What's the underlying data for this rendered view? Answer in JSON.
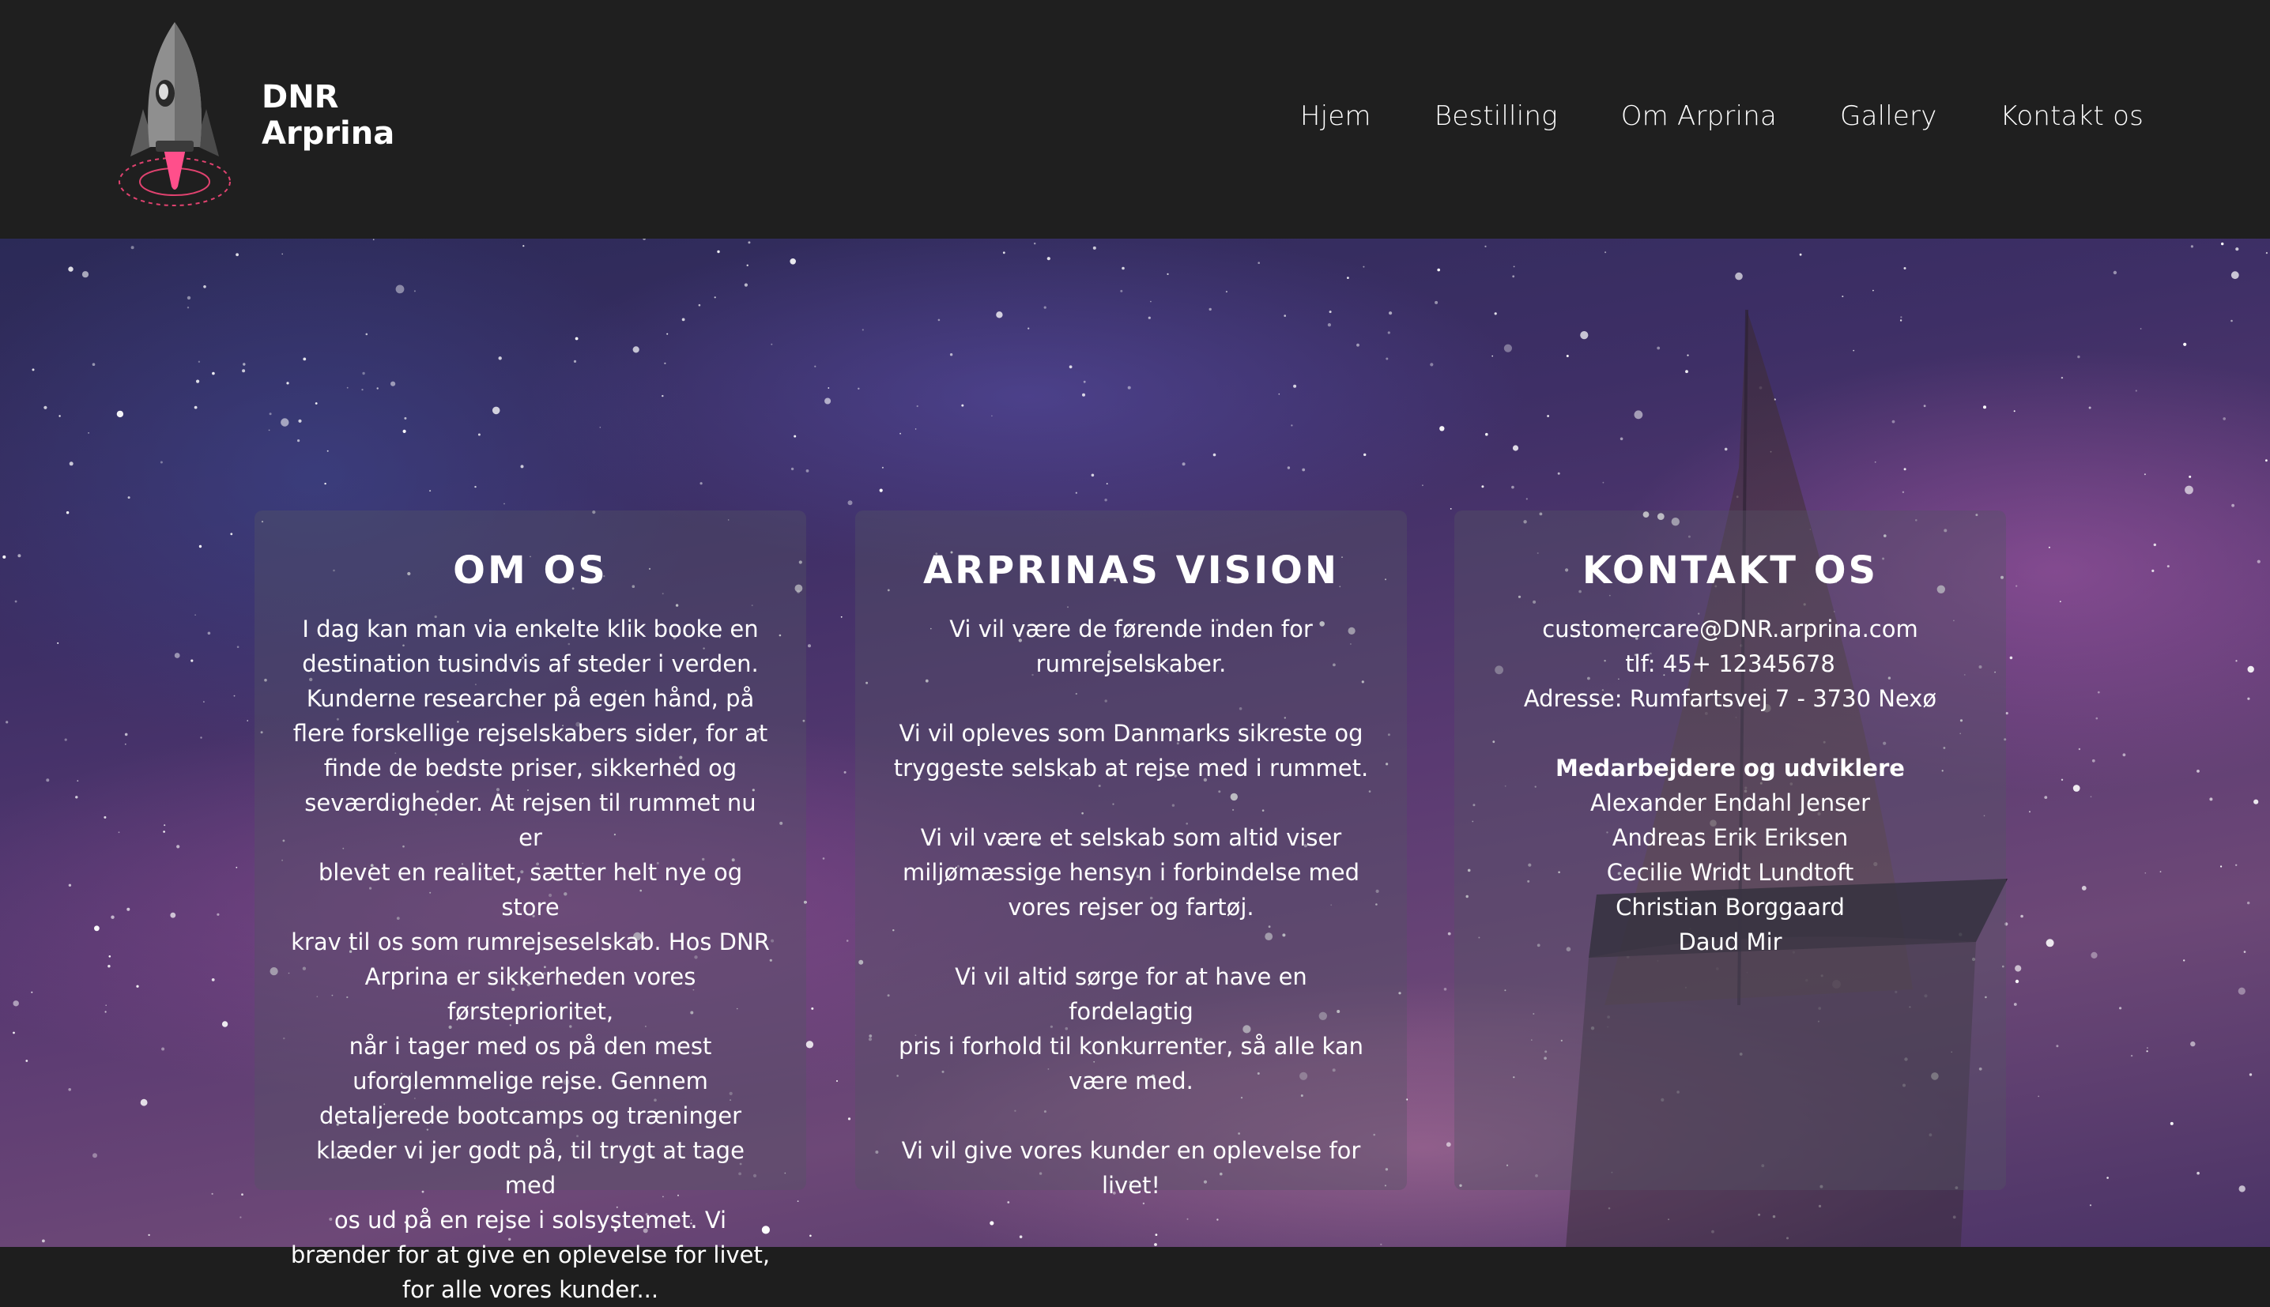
{
  "header": {
    "brand_line1": "DNR",
    "brand_line2": "Arprina",
    "nav": [
      {
        "label": "Hjem"
      },
      {
        "label": "Bestilling"
      },
      {
        "label": "Om Arprina"
      },
      {
        "label": "Gallery"
      },
      {
        "label": "Kontakt os"
      }
    ]
  },
  "about": {
    "title": "OM OS",
    "text": [
      "I dag kan man via enkelte klik booke en",
      "destination tusindvis af steder i verden.",
      "Kunderne researcher på egen hånd, på",
      "flere forskellige rejselskabers sider, for at",
      "finde de bedste priser, sikkerhed og",
      "seværdigheder. At rejsen til rummet nu er",
      "blevet en realitet, sætter helt nye og store",
      "krav til os som rumrejseselskab. Hos DNR",
      "Arprina er sikkerheden vores førsteprioritet,",
      "når i tager med os på den mest",
      "uforglemmelige rejse. Gennem",
      "detaljerede bootcamps og træninger",
      "klæder vi jer godt på, til trygt at tage med",
      "os ud på en rejse i solsystemet. Vi",
      "brænder for at give en oplevelse for livet,",
      "for alle vores kunder..."
    ]
  },
  "vision": {
    "title": "ARPRINAS VISION",
    "paragraphs": [
      [
        "Vi vil være de førende inden for",
        "rumrejselskaber."
      ],
      [
        "Vi vil opleves som Danmarks sikreste og",
        "tryggeste selskab at rejse med i rummet."
      ],
      [
        "Vi vil være et selskab som altid viser",
        "miljømæssige hensyn i forbindelse med",
        "vores rejser og fartøj."
      ],
      [
        "Vi vil altid sørge for at have en fordelagtig",
        "pris i forhold til konkurrenter, så alle kan",
        "være med."
      ],
      [
        "Vi vil give vores kunder en oplevelse for",
        "livet!"
      ]
    ]
  },
  "contact": {
    "title": "KONTAKT OS",
    "email": "customercare@DNR.arprina.com",
    "phone": "tlf: 45+ 12345678",
    "address": "Adresse: Rumfartsvej 7 - 3730 Nexø",
    "staff_heading": "Medarbejdere og udviklere",
    "staff": [
      "Alexander Endahl Jenser",
      "Andreas Erik Eriksen",
      "Cecilie Wridt Lundtoft",
      "Christian Borggaard",
      "Daud Mir"
    ]
  },
  "colors": {
    "header_bg": "#1f1f1f",
    "flame": "#ff4f8b",
    "text": "#ffffff"
  }
}
